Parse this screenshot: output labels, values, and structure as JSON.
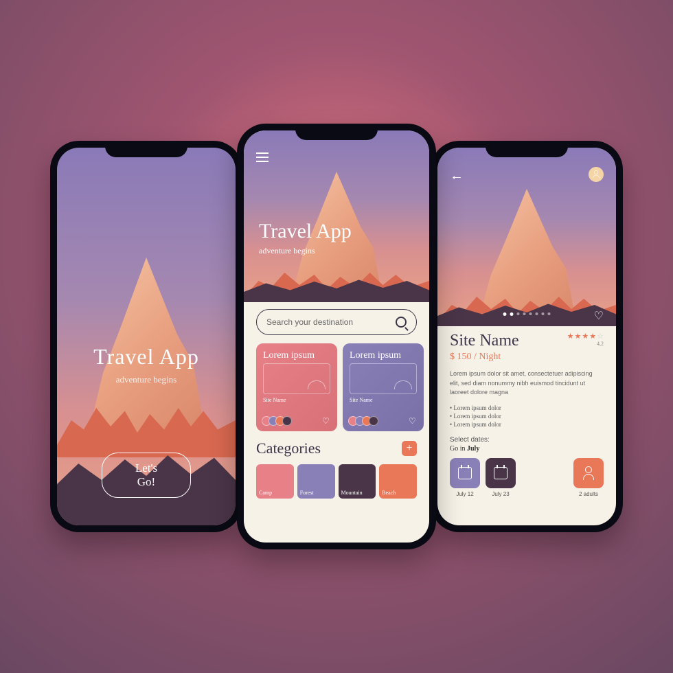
{
  "screen1": {
    "title": "Travel App",
    "subtitle": "adventure begins",
    "cta": "Let's Go!"
  },
  "screen2": {
    "title": "Travel App",
    "subtitle": "adventure begins",
    "search_placeholder": "Search your destination",
    "cards": [
      {
        "title": "Lorem ipsum",
        "site": "Site Name"
      },
      {
        "title": "Lorem ipsum",
        "site": "Site Name"
      }
    ],
    "categories_title": "Categories",
    "categories": [
      "Camp",
      "Forest",
      "Mountain",
      "Beach"
    ]
  },
  "screen3": {
    "site_name": "Site Name",
    "price": "$ 150 / Night",
    "rating": "4,2",
    "description": "Lorem ipsum dolor sit amet, consectetuer adipiscing elit, sed diam nonummy nibh euismod tincidunt ut laoreet dolore magna",
    "bullets": [
      "• Lorem ipsum dolor",
      "• Lorem ipsum dolor",
      "• Lorem ipsum dolor"
    ],
    "select_dates": "Select dates:",
    "go_in_prefix": "Go in ",
    "go_in_month": "July",
    "date1": "July 12",
    "date2": "July 23",
    "adults": "2 adults"
  }
}
